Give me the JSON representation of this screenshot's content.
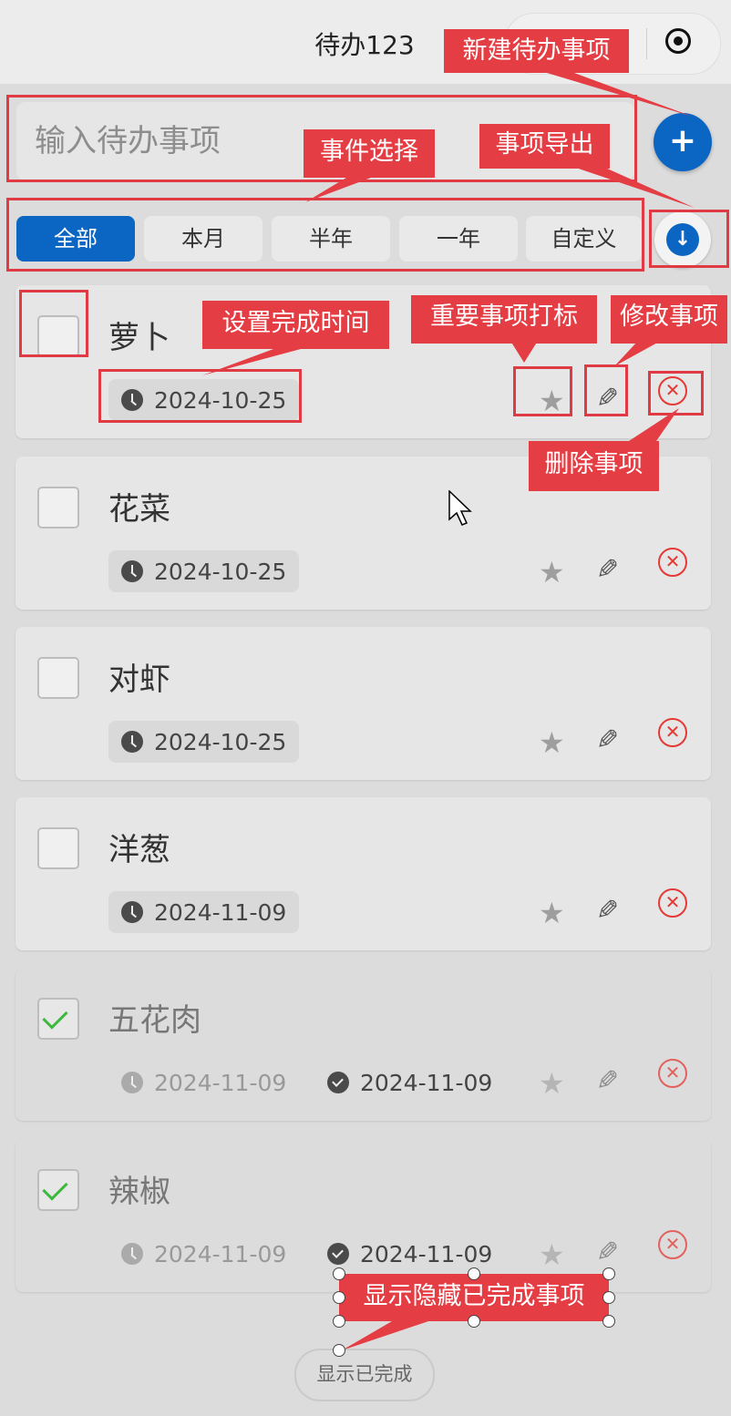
{
  "header": {
    "title": "待办123"
  },
  "input": {
    "placeholder": "输入待办事项"
  },
  "filters": [
    {
      "label": "全部",
      "active": true
    },
    {
      "label": "本月",
      "active": false
    },
    {
      "label": "半年",
      "active": false
    },
    {
      "label": "一年",
      "active": false
    },
    {
      "label": "自定义",
      "active": false
    }
  ],
  "tasks": [
    {
      "name": "萝卜",
      "date": "2024-10-25",
      "completed": false
    },
    {
      "name": "花菜",
      "date": "2024-10-25",
      "completed": false
    },
    {
      "name": "对虾",
      "date": "2024-10-25",
      "completed": false
    },
    {
      "name": "洋葱",
      "date": "2024-11-09",
      "completed": false
    },
    {
      "name": "五花肉",
      "date": "2024-11-09",
      "completed": true,
      "done_date": "2024-11-09"
    },
    {
      "name": "辣椒",
      "date": "2024-11-09",
      "completed": true,
      "done_date": "2024-11-09"
    }
  ],
  "show_done_label": "显示已完成",
  "annotations": {
    "new_todo": "新建待办事项",
    "event_select": "事件选择",
    "export": "事项导出",
    "set_time": "设置完成时间",
    "mark_important": "重要事项打标",
    "edit": "修改事项",
    "delete": "删除事项",
    "toggle_done": "显示隐藏已完成事项"
  },
  "colors": {
    "accent": "#0a66c2",
    "annotation": "#e43d43",
    "delete": "#e53935",
    "check": "#3cb83c"
  },
  "icons": {
    "add": "plus-icon",
    "export": "download-icon",
    "star": "star-icon",
    "edit": "pencil-icon",
    "delete": "close-circle-icon"
  }
}
